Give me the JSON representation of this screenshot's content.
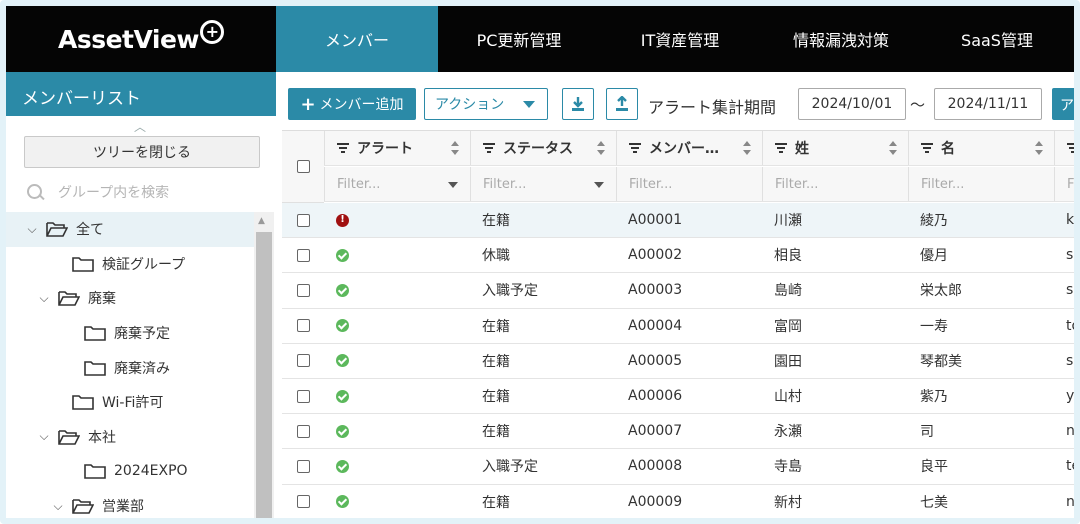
{
  "app": {
    "logo_text": "AssetView",
    "logo_plus": "+"
  },
  "nav": {
    "tabs": [
      {
        "label": "メンバー",
        "active": true
      },
      {
        "label": "PC更新管理",
        "active": false
      },
      {
        "label": "IT資産管理",
        "active": false
      },
      {
        "label": "情報漏洩対策",
        "active": false
      },
      {
        "label": "SaaS管理",
        "active": false
      }
    ]
  },
  "sidebar": {
    "title": "メンバーリスト",
    "close_tree_label": "ツリーを閉じる",
    "search_placeholder": "グループ内を検索",
    "tree": [
      {
        "label": "全て",
        "expanded": true,
        "selected": true
      },
      {
        "label": "検証グループ",
        "expanded": null
      },
      {
        "label": "廃棄",
        "expanded": true
      },
      {
        "label": "廃棄予定",
        "expanded": null
      },
      {
        "label": "廃棄済み",
        "expanded": null
      },
      {
        "label": "Wi-Fi許可",
        "expanded": null
      },
      {
        "label": "本社",
        "expanded": true
      },
      {
        "label": "2024EXPO",
        "expanded": null
      },
      {
        "label": "営業部",
        "expanded": true
      }
    ]
  },
  "toolbar": {
    "add_member_label": "メンバー追加",
    "action_label": "アクション",
    "alert_period_label": "アラート集計期間",
    "date_from": "2024/10/01",
    "tilde": "～",
    "date_to": "2024/11/11",
    "cut_button_label": "アク"
  },
  "grid": {
    "columns": [
      "アラート",
      "ステータス",
      "メンバー…",
      "姓",
      "名",
      ""
    ],
    "filter_placeholder": "Filter...",
    "rows": [
      {
        "alert": "error",
        "status": "在籍",
        "member_id": "A00001",
        "last": "川瀬",
        "first": "綾乃",
        "extra": "ka"
      },
      {
        "alert": "ok",
        "status": "休職",
        "member_id": "A00002",
        "last": "相良",
        "first": "優月",
        "extra": "sa"
      },
      {
        "alert": "ok",
        "status": "入職予定",
        "member_id": "A00003",
        "last": "島崎",
        "first": "栄太郎",
        "extra": "sh"
      },
      {
        "alert": "ok",
        "status": "在籍",
        "member_id": "A00004",
        "last": "富岡",
        "first": "一寿",
        "extra": "to"
      },
      {
        "alert": "ok",
        "status": "在籍",
        "member_id": "A00005",
        "last": "園田",
        "first": "琴都美",
        "extra": "so"
      },
      {
        "alert": "ok",
        "status": "在籍",
        "member_id": "A00006",
        "last": "山村",
        "first": "紫乃",
        "extra": "ya"
      },
      {
        "alert": "ok",
        "status": "在籍",
        "member_id": "A00007",
        "last": "永瀬",
        "first": "司",
        "extra": "na"
      },
      {
        "alert": "ok",
        "status": "入職予定",
        "member_id": "A00008",
        "last": "寺島",
        "first": "良平",
        "extra": "te"
      },
      {
        "alert": "ok",
        "status": "在籍",
        "member_id": "A00009",
        "last": "新村",
        "first": "七美",
        "extra": "ni"
      }
    ]
  },
  "colors": {
    "accent": "#2b8aa7",
    "topbar": "#050505",
    "ok": "#5cb85c",
    "error": "#a01010"
  }
}
